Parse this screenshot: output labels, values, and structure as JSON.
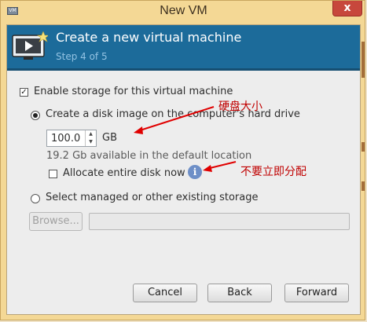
{
  "window": {
    "title": "New VM",
    "app_icon": "vm-icon",
    "close_glyph": "x"
  },
  "header": {
    "title": "Create a new virtual machine",
    "step": "Step 4 of 5",
    "icon": "monitor-play-icon"
  },
  "storage": {
    "enable_label": "Enable storage for this virtual machine",
    "enable_checked": true,
    "create_disk_label": "Create a disk image on the computer's hard drive",
    "create_disk_selected": true,
    "size_value": "100.0",
    "size_unit": "GB",
    "available_text": "19.2 Gb available in the default location",
    "allocate_label": "Allocate entire disk now",
    "allocate_checked": false,
    "managed_label": "Select managed or other existing storage",
    "managed_selected": false,
    "browse_label": "Browse...",
    "path_value": ""
  },
  "annotations": {
    "disk_size": "硬盘大小",
    "do_not_allocate": "不要立即分配"
  },
  "buttons": {
    "cancel": "Cancel",
    "back": "Back",
    "forward": "Forward"
  },
  "colors": {
    "header_bg": "#1c6b9a",
    "window_frame": "#f4d895",
    "close_button": "#c7473c",
    "annotation": "#c00000"
  }
}
